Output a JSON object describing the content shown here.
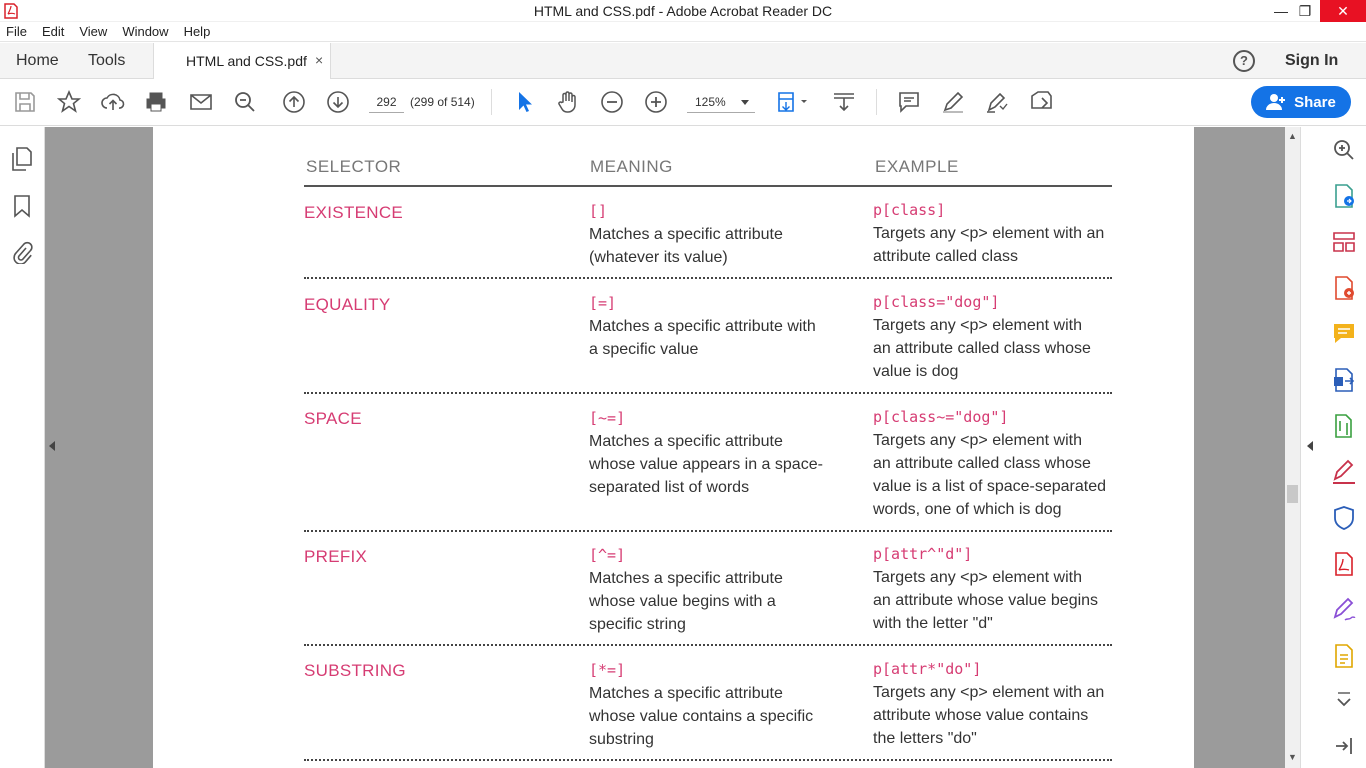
{
  "window": {
    "title": "HTML and CSS.pdf - Adobe Acrobat Reader DC",
    "minimize": "—",
    "restore": "❐",
    "close": "✕"
  },
  "menu": [
    "File",
    "Edit",
    "View",
    "Window",
    "Help"
  ],
  "tabs": {
    "home": "Home",
    "tools": "Tools",
    "document": "HTML and CSS.pdf",
    "close": "×"
  },
  "header": {
    "help": "?",
    "signin": "Sign In"
  },
  "toolbar": {
    "page_number": "292",
    "page_of": "(299 of 514)",
    "zoom": "125%",
    "share_label": "Share"
  },
  "table": {
    "headers": [
      "SELECTOR",
      "MEANING",
      "EXAMPLE"
    ],
    "rows": [
      {
        "name": "EXISTENCE",
        "symbol": "[]",
        "meaning": [
          "Matches a specific attribute",
          "(whatever its value)"
        ],
        "example_code": "p[class]",
        "example": [
          "Targets any <p> element with an",
          "attribute called class"
        ]
      },
      {
        "name": "EQUALITY",
        "symbol": "[=]",
        "meaning": [
          "Matches a specific attribute with",
          "a specific value"
        ],
        "example_code": "p[class=\"dog\"]",
        "example": [
          "Targets any <p> element with",
          "an attribute called class whose",
          "value is dog"
        ]
      },
      {
        "name": "SPACE",
        "symbol": "[~=]",
        "meaning": [
          "Matches a specific attribute",
          "whose value appears in a space-",
          "separated list of words"
        ],
        "example_code": "p[class~=\"dog\"]",
        "example": [
          "Targets any <p> element with",
          "an attribute called class whose",
          "value is a list of space-separated",
          "words, one of which is dog"
        ]
      },
      {
        "name": "PREFIX",
        "symbol": "[^=]",
        "meaning": [
          "Matches a specific attribute",
          "whose value begins with a",
          "specific string"
        ],
        "example_code": "p[attr^\"d\"]",
        "example": [
          "Targets any <p> element with",
          "an attribute whose value begins",
          "with the letter \"d\""
        ]
      },
      {
        "name": "SUBSTRING",
        "symbol": "[*=]",
        "meaning": [
          "Matches a specific attribute",
          "whose value contains a specific",
          "substring"
        ],
        "example_code": "p[attr*\"do\"]",
        "example": [
          "Targets any <p> element with an",
          "attribute whose value contains",
          "the letters \"do\""
        ]
      }
    ]
  },
  "colors": {
    "accent_pink": "#d63c73",
    "share_blue": "#1473e6",
    "doc_gray": "#9b9b9b"
  }
}
